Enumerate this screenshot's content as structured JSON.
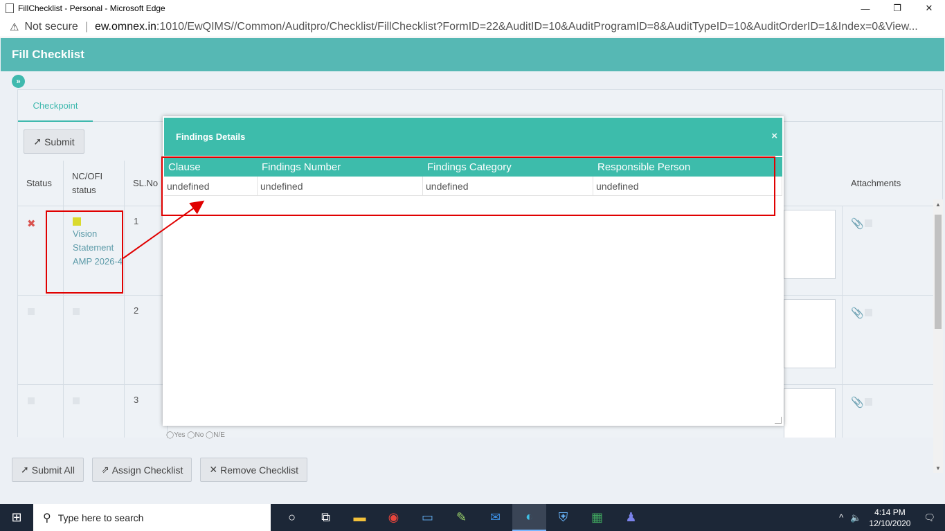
{
  "browser": {
    "window_title": "FillChecklist - Personal - Microsoft Edge",
    "not_secure": "Not secure",
    "url_host": "ew.omnex.in",
    "url_rest": ":1010/EwQIMS//Common/Auditpro/Checklist/FillChecklist?FormID=22&AuditID=10&AuditProgramID=8&AuditTypeID=10&AuditOrderID=1&Index=0&View...",
    "controls": {
      "minimize": "—",
      "restore": "❐",
      "close": "✕"
    }
  },
  "app": {
    "title": "Fill Checklist",
    "expand_icon": "»",
    "tab_checkpoint": "Checkpoint",
    "submit_label": "Submit",
    "columns": {
      "status": "Status",
      "nc_ofi": "NC/OFI status",
      "slno": "SL.No",
      "attachments": "Attachments"
    },
    "rows": [
      {
        "sl": "1",
        "status": "✖",
        "nc_text": "Vision Statement AMP 2026-4"
      },
      {
        "sl": "2"
      },
      {
        "sl": "3"
      }
    ],
    "radio_hint": "◯Yes ◯No ◯N/E",
    "footer": {
      "submit_all": "Submit All",
      "assign_checklist": "Assign Checklist",
      "remove_checklist": "Remove Checklist"
    }
  },
  "modal": {
    "title": "Findings Details",
    "close": "×",
    "headers": [
      "Clause",
      "Findings Number",
      "Findings Category",
      "Responsible Person"
    ],
    "row": [
      "undefined",
      "undefined",
      "undefined",
      "undefined"
    ]
  },
  "taskbar": {
    "search_placeholder": "Type here to search",
    "time": "4:14 PM",
    "date": "12/10/2020"
  },
  "colors": {
    "header_teal": "#56b8b4",
    "modal_teal": "#3dbcab",
    "annotation_red": "#e00000",
    "nc_yellow": "#dada2e"
  }
}
